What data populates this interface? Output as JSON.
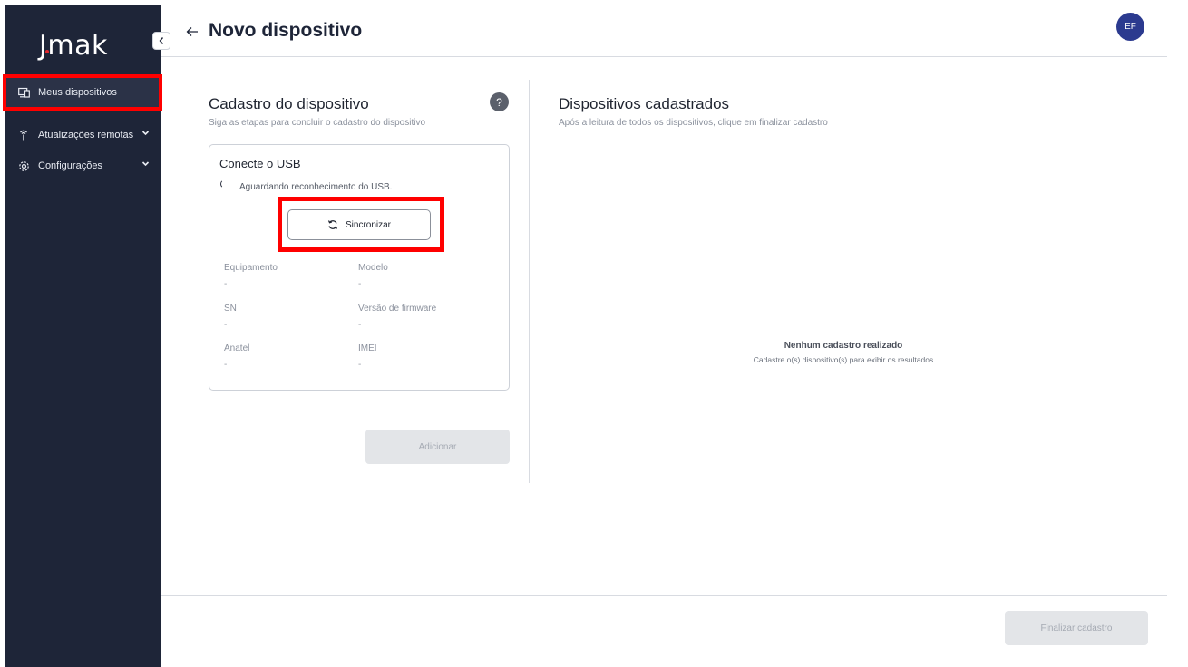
{
  "sidebar": {
    "logo": "Jmak",
    "collapse_icon": "chevron-left-icon",
    "items": [
      {
        "label": "Meus dispositivos",
        "icon": "devices-icon",
        "active": true
      },
      {
        "label": "Atualizações remotas",
        "icon": "antenna-icon",
        "expandable": true
      },
      {
        "label": "Configurações",
        "icon": "gear-icon",
        "expandable": true
      }
    ]
  },
  "header": {
    "back_icon": "arrow-left-icon",
    "title": "Novo dispositivo",
    "avatar_initials": "EF"
  },
  "registration": {
    "title": "Cadastro do dispositivo",
    "subtitle": "Siga as etapas para concluir o cadastro do dispositivo",
    "help_label": "?",
    "card": {
      "title": "Conecte o USB",
      "waiting_text": "Aguardando reconhecimento do USB.",
      "sync_button": "Sincronizar",
      "fields": [
        {
          "label": "Equipamento",
          "value": "-"
        },
        {
          "label": "Modelo",
          "value": "-"
        },
        {
          "label": "SN",
          "value": "-"
        },
        {
          "label": "Versão de firmware",
          "value": "-"
        },
        {
          "label": "Anatel",
          "value": "-"
        },
        {
          "label": "IMEI",
          "value": "-"
        }
      ]
    },
    "add_button": "Adicionar"
  },
  "registered": {
    "title": "Dispositivos cadastrados",
    "subtitle": "Após a leitura de todos os dispositivos, clique em finalizar cadastro",
    "empty_title": "Nenhum cadastro realizado",
    "empty_subtitle": "Cadastre o(s) dispositivo(s) para exibir os resultados"
  },
  "footer": {
    "finish_button": "Finalizar cadastro"
  },
  "colors": {
    "sidebar_bg": "#1e2538",
    "avatar_bg": "#2b3a8f",
    "highlight": "#ff0000"
  }
}
